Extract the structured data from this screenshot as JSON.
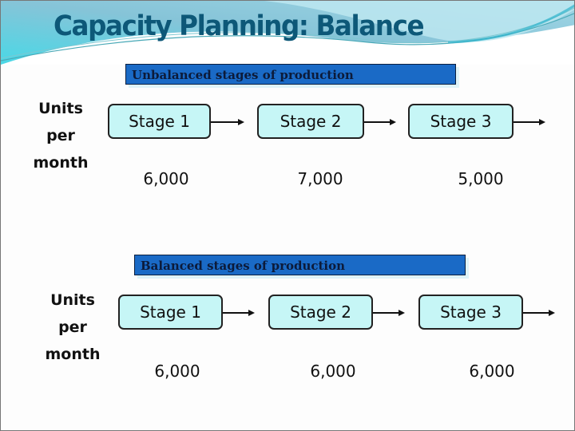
{
  "title": "Capacity Planning: Balance",
  "unbalanced": {
    "banner": "Unbalanced stages of production",
    "row_label": [
      "Units",
      "per",
      "month"
    ],
    "stages": [
      {
        "label": "Stage 1",
        "value": "6,000"
      },
      {
        "label": "Stage 2",
        "value": "7,000"
      },
      {
        "label": "Stage 3",
        "value": "5,000"
      }
    ]
  },
  "balanced": {
    "banner": "Balanced stages of production",
    "row_label": [
      "Units",
      "per",
      "month"
    ],
    "stages": [
      {
        "label": "Stage 1",
        "value": "6,000"
      },
      {
        "label": "Stage 2",
        "value": "6,000"
      },
      {
        "label": "Stage 3",
        "value": "6,000"
      }
    ]
  },
  "colors": {
    "title": "#0d5878",
    "banner_fill": "#1a6ac6",
    "stage_fill": "#c6f6f6"
  }
}
